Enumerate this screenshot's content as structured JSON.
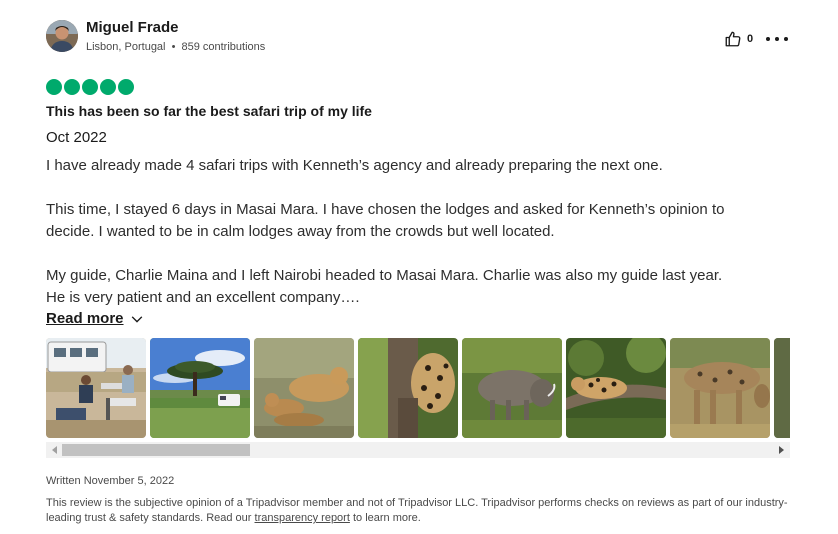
{
  "author": {
    "name": "Miguel Frade",
    "location": "Lisbon, Portugal",
    "separator": "•",
    "contributions": "859 contributions",
    "avatar_icon": "user-avatar"
  },
  "actions": {
    "helpful_count": "0",
    "helpful_icon": "thumbs-up-icon",
    "more_icon": "more-options-icon"
  },
  "rating": {
    "value": 5,
    "max": 5,
    "color": "#00aa6c"
  },
  "review": {
    "title": "This has been so far the best safari trip of my life",
    "date": "Oct 2022",
    "body": {
      "line1": "I have already made 4 safari trips with Kenneth’s agency and already preparing the next one.",
      "line2": "This time, I stayed 6 days in Masai Mara. I have chosen the lodges and asked for Kenneth’s opinion to",
      "line3": "decide. I wanted to be in calm lodges away from the crowds but well located.",
      "line4": "My guide, Charlie Maina and I left Nairobi headed to Masai Mara. Charlie was also my guide last year.",
      "line5": "He is very patient and an excellent company…."
    },
    "read_more_label": "Read more"
  },
  "gallery": {
    "photos": [
      {
        "name": "photo-safari-vehicle-picnic"
      },
      {
        "name": "photo-acacia-tree-landscape"
      },
      {
        "name": "photo-lionesses"
      },
      {
        "name": "photo-leopard-in-tree"
      },
      {
        "name": "photo-warthogs"
      },
      {
        "name": "photo-leopard-on-branch"
      },
      {
        "name": "photo-hyena"
      },
      {
        "name": "photo-partial-edge"
      }
    ]
  },
  "footer": {
    "written_date": "Written November 5, 2022",
    "disclaimer_part1": "This review is the subjective opinion of a Tripadvisor member and not of Tripadvisor LLC. Tripadvisor performs checks on reviews as part of our industry-leading trust & safety standards. Read our ",
    "transparency_link": "transparency report",
    "disclaimer_part2": " to learn more."
  }
}
